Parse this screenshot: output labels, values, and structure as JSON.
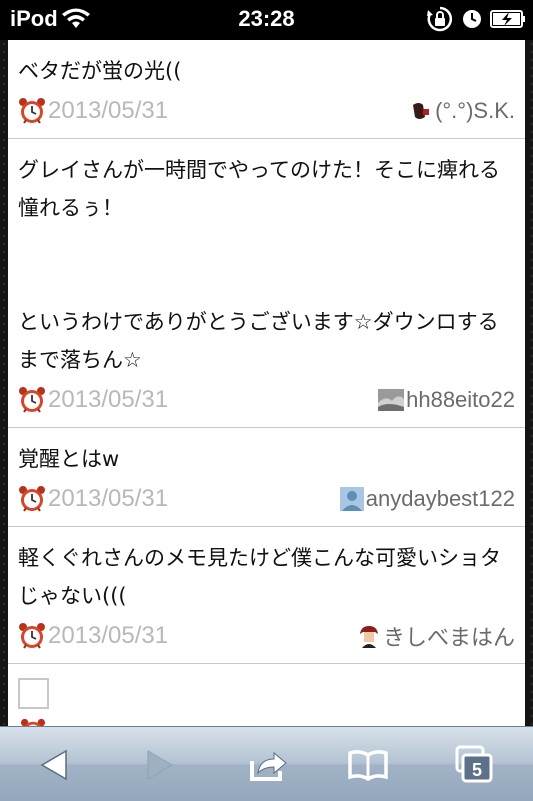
{
  "status_bar": {
    "carrier": "iPod",
    "time": "23:28",
    "icons": [
      "wifi-icon",
      "rotation-lock-icon",
      "alarm-icon",
      "battery-charging-icon"
    ]
  },
  "posts": [
    {
      "text": "ベタだが蛍の光((",
      "date": "2013/05/31",
      "username": "(°.°)S.K."
    },
    {
      "text": "グレイさんが一時間でやってのけた！そこに痺れる憧れるぅ！\n\n\nというわけでありがとうございます☆ダウンロするまで落ちん☆",
      "date": "2013/05/31",
      "username": "hh88eito22"
    },
    {
      "text": "覚醒とはw",
      "date": "2013/05/31",
      "username": "anydaybest122"
    },
    {
      "text": "軽くぐれさんのメモ見たけど僕こんな可愛いショタじゃない(((",
      "date": "2013/05/31",
      "username": "きしべまはん"
    }
  ],
  "toolbar": {
    "buttons": [
      "back-icon",
      "forward-icon",
      "share-icon",
      "bookmarks-icon",
      "tabs-icon"
    ],
    "tabs_count": "5"
  },
  "colors": {
    "date_text": "#b8b8b8",
    "username_text": "#6b6b6b",
    "toolbar_top": "#d8e1ea",
    "toolbar_bottom": "#94a7bd"
  }
}
